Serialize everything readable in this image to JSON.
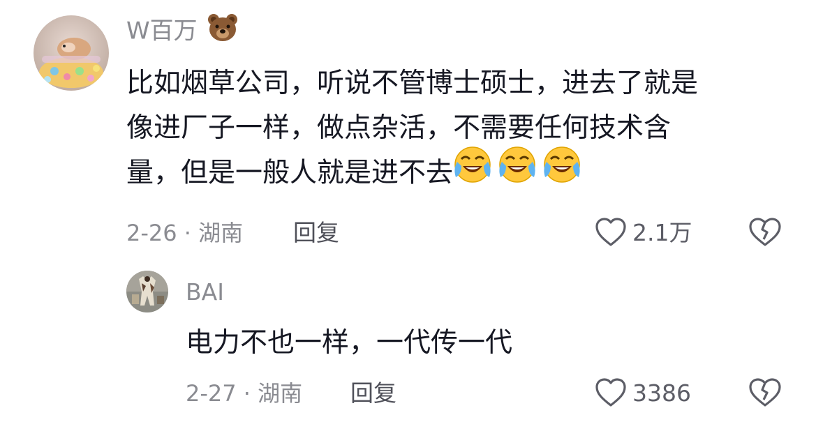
{
  "comments": [
    {
      "author": "W百万",
      "author_emoji": "bear-face-icon",
      "text_lines": [
        "比如烟草公司，听说不管博士硕士，进去了就是",
        "像进厂子一样，做点杂活，不需要任何技术含",
        "量，但是一般人就是进不去"
      ],
      "trailing_emojis": [
        "face-with-tears-of-joy-icon",
        "face-with-tears-of-joy-icon",
        "face-with-tears-of-joy-icon"
      ],
      "date_location": "2-26 · 湖南",
      "reply_label": "回复",
      "like_count": "2.1万",
      "avatar": "hamster-avatar"
    },
    {
      "author": "BAI",
      "text": "电力不也一样，一代传一代",
      "date_location": "2-27 · 湖南",
      "reply_label": "回复",
      "like_count": "3386",
      "avatar": "figure-avatar"
    }
  ],
  "colors": {
    "primary_text": "#161823",
    "secondary_text": "#8a8b91",
    "icon": "#5c5d66"
  }
}
